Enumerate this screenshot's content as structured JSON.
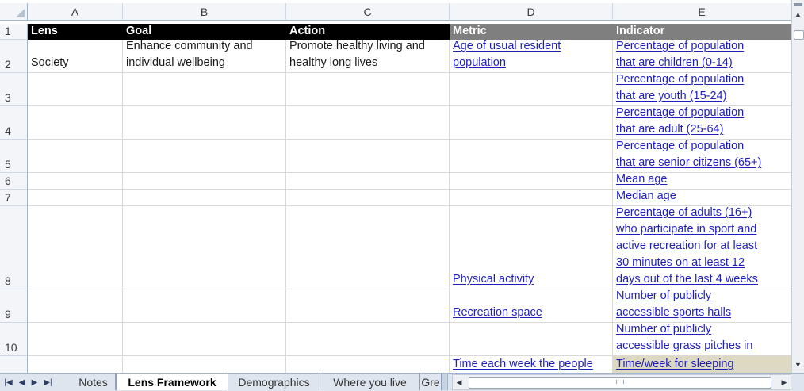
{
  "columns": [
    "A",
    "B",
    "C",
    "D",
    "E"
  ],
  "header_row": {
    "row_num": "1",
    "cells": [
      "Lens",
      "Goal",
      "Action",
      "Metric",
      "Indicator"
    ]
  },
  "rows": [
    {
      "num": "2",
      "a": "Society",
      "b": "Enhance community and\nindividual wellbeing",
      "c": "Promote healthy living and\nhealthy long lives",
      "d": "Age of usual resident\npopulation",
      "e": "Percentage of population\nthat are children (0-14)"
    },
    {
      "num": "3",
      "a": "",
      "b": "",
      "c": "",
      "d": "",
      "e": "Percentage of population\nthat are youth (15-24)"
    },
    {
      "num": "4",
      "a": "",
      "b": "",
      "c": "",
      "d": "",
      "e": "Percentage of population\nthat are adult (25-64)"
    },
    {
      "num": "5",
      "a": "",
      "b": "",
      "c": "",
      "d": "",
      "e": "Percentage of population\nthat are senior citizens (65+)"
    },
    {
      "num": "6",
      "a": "",
      "b": "",
      "c": "",
      "d": "",
      "e": "Mean age"
    },
    {
      "num": "7",
      "a": "",
      "b": "",
      "c": "",
      "d": "",
      "e": "Median age"
    },
    {
      "num": "8",
      "a": "",
      "b": "",
      "c": "",
      "d": "Physical activity",
      "e": "Percentage of adults (16+)\nwho participate in sport and\nactive recreation for at least\n30 minutes on at least 12\ndays out of the last 4 weeks"
    },
    {
      "num": "9",
      "a": "",
      "b": "",
      "c": "",
      "d": "Recreation space",
      "e": "Number of publicly\naccessible sports halls"
    },
    {
      "num": "10",
      "a": "",
      "b": "",
      "c": "",
      "d": "",
      "e": "Number of publicly\naccessible grass pitches in"
    },
    {
      "num": "",
      "a": "",
      "b": "",
      "c": "",
      "d": "Time each week the people",
      "e": "Time/week for sleeping"
    }
  ],
  "sheet_tabs": {
    "tabs": [
      "Notes",
      "Lens Framework",
      "Demographics",
      "Where you live",
      "Gre"
    ],
    "active": "Lens Framework"
  },
  "colors": {
    "header_black": "#000000",
    "header_gray": "#7f7f7f",
    "link_blue": "#1f1fbf",
    "highlight_tan": "#ddd9c3"
  },
  "icons": [
    "first-sheet-icon",
    "prev-sheet-icon",
    "next-sheet-icon",
    "last-sheet-icon",
    "scroll-left-icon",
    "scroll-right-icon",
    "scroll-up-icon",
    "scroll-down-icon"
  ]
}
